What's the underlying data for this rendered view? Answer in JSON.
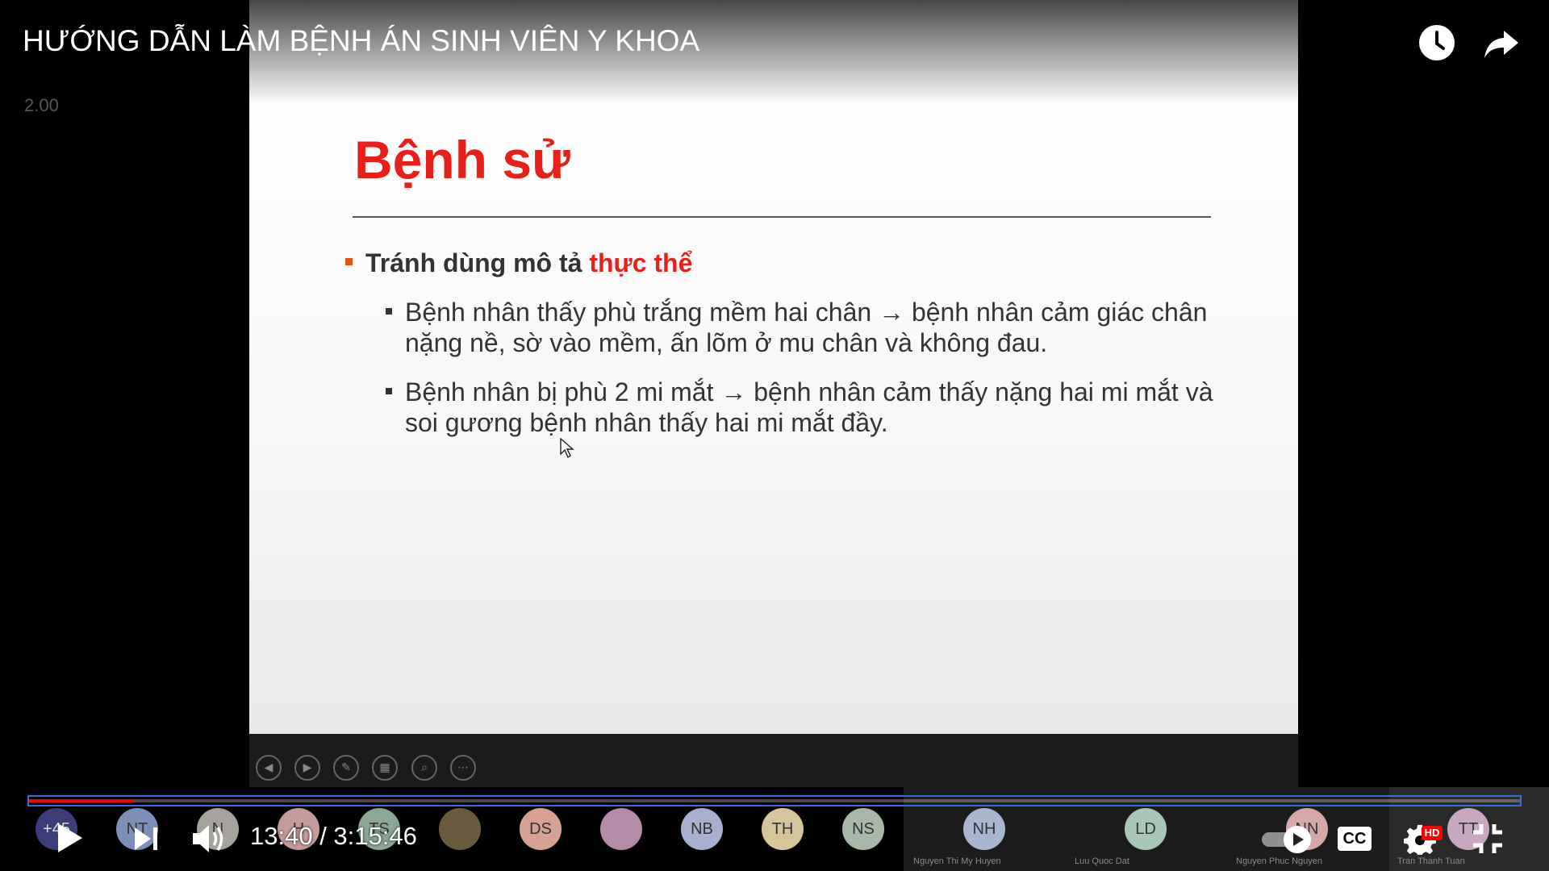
{
  "video": {
    "title": "HƯỚNG DẪN LÀM BỆNH ÁN SINH VIÊN Y KHOA",
    "speed": "2.00",
    "time_display": "13:40 / 3:15:46",
    "progress_fraction": 0.07
  },
  "slide": {
    "title": "Bệnh sử",
    "bullet_main": "Tránh dùng mô tả ",
    "bullet_main_highlight": "thực thể",
    "sub_bullets": [
      "Bệnh nhân thấy phù trắng mềm hai chân → bệnh nhân cảm giác chân nặng nề, sờ vào mềm, ấn lõm ở mu chân và không đau.",
      "Bệnh nhân bị phù 2 mi mắt → bệnh nhân cảm thấy nặng hai mi mắt và soi gương bệnh nhân thấy hai mi mắt đầy."
    ],
    "toolbar_icons": [
      "prev-slide-icon",
      "next-slide-icon",
      "pen-icon",
      "slides-grid-icon",
      "zoom-icon",
      "more-icon"
    ]
  },
  "participants": [
    {
      "initials": "+45",
      "color": "#3c3c78"
    },
    {
      "initials": "NT",
      "color": "#7b8fb8"
    },
    {
      "initials": "N",
      "color": "#a6a29c"
    },
    {
      "initials": "H",
      "color": "#c49a9a"
    },
    {
      "initials": "TS",
      "color": "#8aa894"
    },
    {
      "initials": "",
      "color": "#6b5b3e"
    },
    {
      "initials": "DS",
      "color": "#d6a092"
    },
    {
      "initials": "",
      "color": "#b48ca8"
    },
    {
      "initials": "NB",
      "color": "#a8b0d2"
    },
    {
      "initials": "TH",
      "color": "#d6c49a"
    },
    {
      "initials": "NS",
      "color": "#a8b8a8"
    },
    {
      "initials": "NH",
      "color": "#a8b6d0",
      "name": "Nguyen Thi My Huyen"
    },
    {
      "initials": "LD",
      "color": "#a8c6b6",
      "name": "Luu Quoc Dat"
    },
    {
      "initials": "NN",
      "color": "#d8a8a8",
      "name": "Nguyen Phuc Nguyen"
    },
    {
      "initials": "TT",
      "color": "#c8a8c0",
      "name": "Tran Thanh Tuan"
    }
  ],
  "controls": {
    "play_icon": "play-icon",
    "next_icon": "next-icon",
    "volume_icon": "volume-icon",
    "autoplay_icon": "autoplay-toggle-icon",
    "cc_label": "CC",
    "hd_badge": "HD",
    "settings_icon": "gear-icon",
    "exit_fullscreen_icon": "exit-fullscreen-icon",
    "watch_later_icon": "clock-icon",
    "share_icon": "share-icon"
  },
  "colors": {
    "accent_red": "#ff0000",
    "slide_title_red": "#e8201c",
    "progress_focus_border": "#2d6fd6"
  }
}
